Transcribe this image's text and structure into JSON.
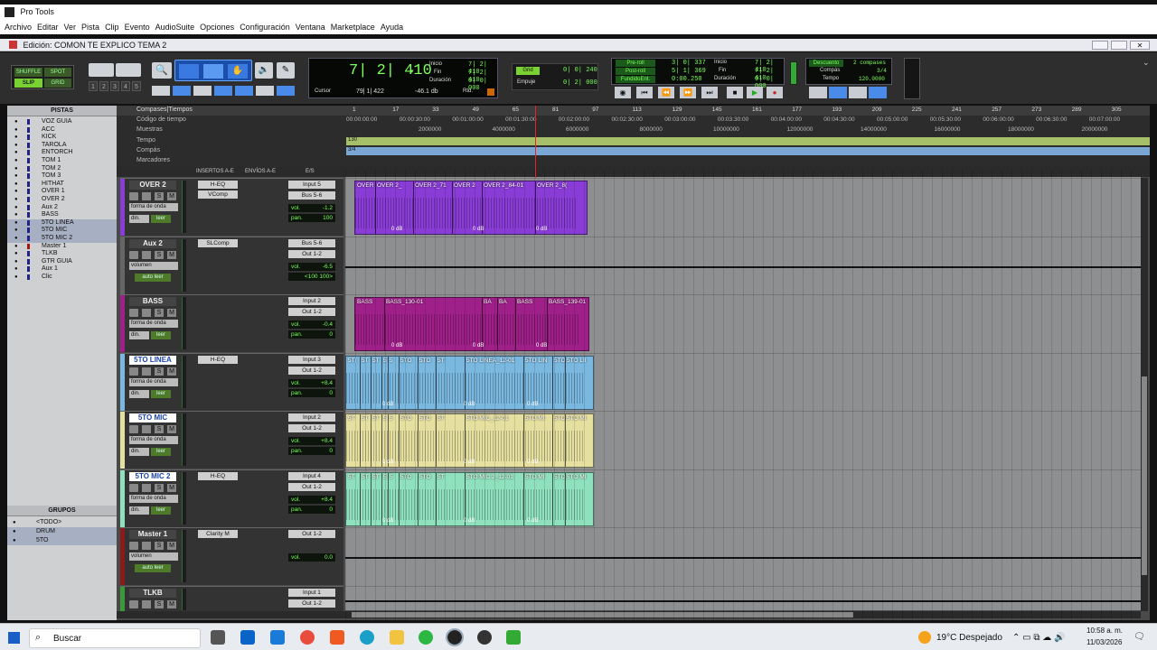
{
  "window": {
    "title": "Pro Tools",
    "edit_title": "Edición: COMON TE EXPLICO TEMA 2"
  },
  "menu": [
    "Archivo",
    "Editar",
    "Ver",
    "Pista",
    "Clip",
    "Evento",
    "AudioSuite",
    "Opciones",
    "Configuración",
    "Ventana",
    "Marketplace",
    "Ayuda"
  ],
  "modes": {
    "shuffle": "SHUFFLE",
    "spot": "SPOT",
    "slip": "SLIP",
    "grid": "GRID"
  },
  "zoom_presets": [
    "1",
    "2",
    "3",
    "4",
    "5"
  ],
  "main_counter": {
    "value": "7| 2| 410",
    "inicio_label": "Inicio",
    "fin_label": "Fin",
    "duracion_label": "Duración",
    "inicio": "7| 2| 410",
    "fin": "7| 2| 410",
    "duracion": "0| 0| 000",
    "cursor_label": "Cursor",
    "cursor": "79| 1| 422",
    "level": "-46.1 db",
    "rtd": "Rtd."
  },
  "grid_nudge": {
    "grid_label": "Grid",
    "grid": "0| 0| 240",
    "nudge_label": "Empuje",
    "nudge": "0| 2| 000"
  },
  "preroll": {
    "pre_label": "Pre-roll",
    "post_label": "Post-roll",
    "fade_label": "FundidoEnt.",
    "pre": "3| 0| 337",
    "post": "5| 1| 369",
    "fade": "0:00.250",
    "inicio_label": "Inicio",
    "fin_label": "Fin",
    "duracion_label": "Duración",
    "inicio": "7| 2| 410",
    "fin": "7| 2| 410",
    "duracion": "0| 0| 000"
  },
  "meter_panel": {
    "desc_label": "Descuento",
    "bars": "2 compases",
    "compas_label": "Compás",
    "meter": "3/4",
    "tempo_label": "Tempo",
    "tempo": "120.0000"
  },
  "tracks_panel": {
    "title": "PISTAS",
    "items": [
      "VOZ GUIA",
      "ACC",
      "KICK",
      "TAROLA",
      "ENTORCH",
      "TOM 1",
      "TOM 2",
      "TOM 3",
      "HITHAT",
      "OVER 1",
      "OVER 2",
      "Aux 2",
      "BASS",
      "5TO LINEA",
      "5TO MIC",
      "5TO MIC 2",
      "Master 1",
      "TLKB",
      "GTR GUIA",
      "Aux 1",
      "Clic"
    ]
  },
  "groups_panel": {
    "title": "GRUPOS",
    "items": [
      "<TODO>",
      "DRUM",
      "5TO"
    ]
  },
  "rulers": {
    "bars": "Compases|Tiempos",
    "tc": "Código de tiempo",
    "samples": "Muestras",
    "tempo": "Tempo",
    "meter": "Compás",
    "markers": "Marcadores",
    "tempo_value": "130",
    "meter_value": "3/4",
    "bar_ticks": [
      "1",
      "17",
      "33",
      "49",
      "65",
      "81",
      "97",
      "113",
      "129",
      "145",
      "161",
      "177",
      "193",
      "209",
      "225",
      "241",
      "257",
      "273",
      "289",
      "305",
      "321"
    ],
    "tc_ticks": [
      "00:00:00:00",
      "00:00:30:00",
      "00:01:00:00",
      "00:01:30:00",
      "00:02:00:00",
      "00:02:30:00",
      "00:03:00:00",
      "00:03:30:00",
      "00:04:00:00",
      "00:04:30:00",
      "00:05:00:00",
      "00:05:30:00",
      "00:06:00:00",
      "00:06:30:00",
      "00:07:00:00"
    ],
    "sample_ticks": [
      "2000000",
      "4000000",
      "6000000",
      "8000000",
      "10000000",
      "12000000",
      "14000000",
      "16000000",
      "18000000",
      "20000000"
    ]
  },
  "column_headers": {
    "inserts": "INSERTOS A-E",
    "sends": "ENVÍOS A-E",
    "io": "E/S"
  },
  "tracks": [
    {
      "name": "OVER 2",
      "insert1": "H-EQ",
      "insert2": "VComp",
      "in": "Input 5",
      "out": "Bus 5-6",
      "view": "forma de onda",
      "vol": "-1.2",
      "pan": "100",
      "vol_label": "vol.",
      "pan_label": "pan.",
      "din": "din.",
      "leer": "leer",
      "color": "#8a3cd6",
      "clips": [
        "OVER",
        "OVER 2_",
        "OVER 2_71",
        "OVER 2",
        "OVER 2_84-01",
        "OVER 2_8("
      ]
    },
    {
      "name": "Aux 2",
      "insert1": "SLComp",
      "insert2": "",
      "in": "Bus 5-6",
      "out": "Out 1-2",
      "view": "volumen",
      "vol": "-6.5",
      "pan": "<100  100>",
      "vol_label": "vol.",
      "pan_label": "",
      "din": "",
      "leer": "auto leer",
      "color": "#666666",
      "clips": []
    },
    {
      "name": "BASS",
      "insert1": "",
      "insert2": "",
      "in": "Input 2",
      "out": "Out 1-2",
      "view": "forma de onda",
      "vol": "-0.4",
      "pan": "0",
      "vol_label": "vol.",
      "pan_label": "pan.",
      "din": "din.",
      "leer": "leer",
      "color": "#a0208a",
      "clips": [
        "BASS",
        "BASS_130-01",
        "BA",
        "BA",
        "BASS",
        "BASS_139-01"
      ]
    },
    {
      "name": "5TO LINEA",
      "insert1": "H-EQ",
      "insert2": "",
      "in": "Input 3",
      "out": "Out 1-2",
      "view": "forma de onda",
      "vol": "+8.4",
      "pan": "0",
      "vol_label": "vol.",
      "pan_label": "pan.",
      "din": "din.",
      "leer": "leer",
      "color": "#7ab8e0",
      "clips": [
        "5T(",
        "5T",
        "5T",
        "5",
        "5",
        "5TO",
        "5TO",
        "5T",
        "5TO LINEA_12-01",
        "5TO LIN",
        "5TO",
        "5TO LII"
      ]
    },
    {
      "name": "5TO MIC",
      "insert1": "",
      "insert2": "",
      "in": "Input 2",
      "out": "Out 1-2",
      "view": "forma de onda",
      "vol": "+8.4",
      "pan": "0",
      "vol_label": "vol.",
      "pan_label": "pan.",
      "din": "din.",
      "leer": "leer",
      "color": "#e6e0a0",
      "clips": [
        "5T",
        "5T",
        "5T",
        "5",
        "5",
        "5TO",
        "5TO",
        "5T",
        "5TO MIC_12-01",
        "5TO MI",
        "5TO",
        "5TO MI"
      ]
    },
    {
      "name": "5TO MIC 2",
      "insert1": "H-EQ",
      "insert2": "",
      "in": "Input 4",
      "out": "Out 1-2",
      "view": "forma de onda",
      "vol": "+8.4",
      "pan": "0",
      "vol_label": "vol.",
      "pan_label": "pan.",
      "din": "din.",
      "leer": "leer",
      "color": "#8fe0bc",
      "clips": [
        "5T",
        "5T",
        "5T",
        "5",
        "5",
        "5TO",
        "5TO",
        "5T",
        "5TO MIC 2_12-01",
        "5TO MI",
        "5TO",
        "5TO MI"
      ]
    },
    {
      "name": "Master 1",
      "insert1": "Clarity M",
      "insert2": "",
      "in": "Out 1-2",
      "out": "",
      "view": "volumen",
      "vol": "0.0",
      "pan": "",
      "vol_label": "vol.",
      "pan_label": "",
      "din": "",
      "leer": "auto leer",
      "color": "#8b1a1a",
      "clips": []
    },
    {
      "name": "TLKB",
      "insert1": "",
      "insert2": "",
      "in": "Input 1",
      "out": "Out 1-2",
      "view": "",
      "vol": "",
      "pan": "",
      "vol_label": "",
      "pan_label": "",
      "din": "",
      "leer": "",
      "color": "#3a9a3a",
      "clips": []
    }
  ],
  "gain_label": "0 dB",
  "taskbar": {
    "search": "Buscar",
    "weather": "19°C  Despejado",
    "time": "10:58 a. m.",
    "date": "11/03/2026"
  }
}
